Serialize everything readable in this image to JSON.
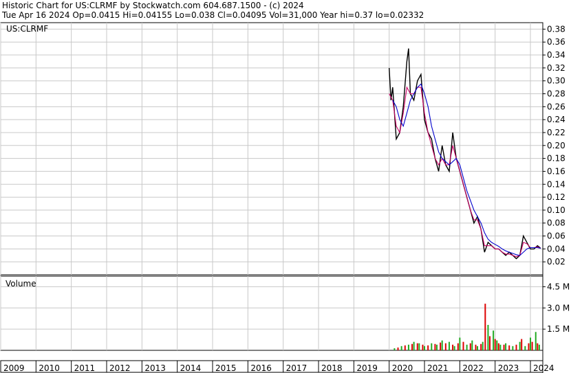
{
  "header": {
    "line1": "Historic Chart for US:CLRMF by Stockwatch.com 604.687.1500 - (c) 2024",
    "line2": "Tue Apr 16 2024   Op=0.0415   Hi=0.04155   Lo=0.038   Cl=0.04095   Vol=31,000   Year hi=0.37   lo=0.02332"
  },
  "chart_data": [
    {
      "type": "line",
      "title": "US:CLRMF",
      "ylim": [
        0.0,
        0.39
      ],
      "yticks": [
        0.02,
        0.04,
        0.06,
        0.08,
        0.1,
        0.12,
        0.14,
        0.16,
        0.18,
        0.2,
        0.22,
        0.24,
        0.26,
        0.28,
        0.3,
        0.32,
        0.34,
        0.36,
        0.38
      ],
      "ytick_labels": [
        "0.02",
        "0.04",
        "0.06",
        "0.08",
        "0.10",
        "0.12",
        "0.14",
        "0.16",
        "0.18",
        "0.20",
        "0.22",
        "0.24",
        "0.26",
        "0.28",
        "0.30",
        "0.32",
        "0.34",
        "0.36",
        "0.38"
      ],
      "xlim": [
        2009.0,
        2024.35
      ],
      "grid": true,
      "series": [
        {
          "color": "#000000",
          "x": [
            2020.0,
            2020.05,
            2020.1,
            2020.15,
            2020.2,
            2020.3,
            2020.4,
            2020.5,
            2020.55,
            2020.6,
            2020.7,
            2020.8,
            2020.9,
            2021.0,
            2021.1,
            2021.2,
            2021.3,
            2021.4,
            2021.5,
            2021.6,
            2021.7,
            2021.8,
            2021.9,
            2022.0,
            2022.1,
            2022.2,
            2022.3,
            2022.4,
            2022.5,
            2022.6,
            2022.7,
            2022.8,
            2022.9,
            2023.0,
            2023.1,
            2023.2,
            2023.3,
            2023.4,
            2023.5,
            2023.6,
            2023.7,
            2023.8,
            2023.9,
            2024.0,
            2024.1,
            2024.2,
            2024.29
          ],
          "y": [
            0.32,
            0.27,
            0.29,
            0.25,
            0.21,
            0.22,
            0.26,
            0.33,
            0.35,
            0.28,
            0.27,
            0.3,
            0.31,
            0.24,
            0.22,
            0.21,
            0.18,
            0.16,
            0.2,
            0.17,
            0.16,
            0.22,
            0.18,
            0.16,
            0.14,
            0.12,
            0.1,
            0.08,
            0.09,
            0.07,
            0.035,
            0.05,
            0.045,
            0.04,
            0.04,
            0.035,
            0.03,
            0.035,
            0.03,
            0.025,
            0.03,
            0.06,
            0.05,
            0.04,
            0.04,
            0.045,
            0.041
          ]
        },
        {
          "color": "#cc0066",
          "x": [
            2020.0,
            2020.1,
            2020.2,
            2020.3,
            2020.4,
            2020.5,
            2020.6,
            2020.7,
            2020.8,
            2020.9,
            2021.0,
            2021.1,
            2021.2,
            2021.3,
            2021.4,
            2021.5,
            2021.6,
            2021.7,
            2021.8,
            2021.9,
            2022.0,
            2022.1,
            2022.2,
            2022.3,
            2022.4,
            2022.5,
            2022.6,
            2022.7,
            2022.8,
            2022.9,
            2023.0,
            2023.1,
            2023.2,
            2023.3,
            2023.4,
            2023.5,
            2023.6,
            2023.7,
            2023.8,
            2023.9,
            2024.0,
            2024.1,
            2024.2,
            2024.29
          ],
          "y": [
            0.28,
            0.27,
            0.23,
            0.22,
            0.25,
            0.29,
            0.28,
            0.28,
            0.29,
            0.29,
            0.25,
            0.22,
            0.2,
            0.18,
            0.17,
            0.18,
            0.17,
            0.17,
            0.2,
            0.18,
            0.16,
            0.14,
            0.12,
            0.1,
            0.085,
            0.085,
            0.07,
            0.045,
            0.045,
            0.045,
            0.04,
            0.04,
            0.035,
            0.032,
            0.032,
            0.03,
            0.028,
            0.03,
            0.05,
            0.048,
            0.042,
            0.042,
            0.043,
            0.041
          ]
        },
        {
          "color": "#0000cc",
          "x": [
            2020.1,
            2020.2,
            2020.3,
            2020.4,
            2020.5,
            2020.6,
            2020.7,
            2020.8,
            2020.9,
            2021.0,
            2021.1,
            2021.2,
            2021.3,
            2021.4,
            2021.5,
            2021.6,
            2021.7,
            2021.8,
            2021.9,
            2022.0,
            2022.1,
            2022.2,
            2022.3,
            2022.4,
            2022.5,
            2022.6,
            2022.7,
            2022.8,
            2022.9,
            2023.0,
            2023.1,
            2023.2,
            2023.3,
            2023.4,
            2023.5,
            2023.6,
            2023.7,
            2023.8,
            2023.9,
            2024.0,
            2024.1,
            2024.2,
            2024.29
          ],
          "y": [
            0.27,
            0.26,
            0.24,
            0.23,
            0.25,
            0.27,
            0.28,
            0.29,
            0.295,
            0.28,
            0.26,
            0.23,
            0.21,
            0.19,
            0.18,
            0.175,
            0.17,
            0.175,
            0.18,
            0.17,
            0.15,
            0.13,
            0.115,
            0.1,
            0.09,
            0.08,
            0.065,
            0.055,
            0.05,
            0.047,
            0.044,
            0.04,
            0.037,
            0.035,
            0.033,
            0.031,
            0.03,
            0.035,
            0.04,
            0.042,
            0.042,
            0.042,
            0.041
          ]
        }
      ]
    },
    {
      "type": "bar",
      "title": "Volume",
      "ylim": [
        0,
        5250000
      ],
      "yticks": [
        1500000,
        3000000,
        4500000
      ],
      "ytick_labels": [
        "1.5 M",
        "3.0 M",
        "4.5 M"
      ],
      "xlim": [
        2009.0,
        2024.35
      ],
      "grid": true,
      "series": [
        {
          "color": "#22aa22",
          "x": [
            2020.15,
            2020.35,
            2020.55,
            2020.7,
            2020.85,
            2021.0,
            2021.2,
            2021.35,
            2021.5,
            2021.7,
            2021.85,
            2022.0,
            2022.2,
            2022.35,
            2022.5,
            2022.65,
            2022.8,
            2022.95,
            2023.05,
            2023.15,
            2023.3,
            2023.5,
            2023.7,
            2023.85,
            2024.0,
            2024.15,
            2024.25
          ],
          "y": [
            150000,
            300000,
            400000,
            600000,
            500000,
            300000,
            500000,
            400000,
            700000,
            600000,
            300000,
            900000,
            400000,
            700000,
            300000,
            600000,
            1800000,
            1400000,
            700000,
            400000,
            500000,
            300000,
            600000,
            300000,
            900000,
            1300000,
            400000
          ]
        },
        {
          "color": "#dd0000",
          "x": [
            2020.25,
            2020.45,
            2020.65,
            2020.8,
            2020.95,
            2021.1,
            2021.3,
            2021.45,
            2021.6,
            2021.8,
            2021.95,
            2022.1,
            2022.3,
            2022.45,
            2022.6,
            2022.72,
            2022.85,
            2023.0,
            2023.1,
            2023.25,
            2023.4,
            2023.6,
            2023.75,
            2023.95,
            2024.05,
            2024.2
          ],
          "y": [
            200000,
            350000,
            450000,
            500000,
            400000,
            350000,
            450000,
            550000,
            500000,
            400000,
            500000,
            600000,
            500000,
            400000,
            450000,
            3300000,
            1000000,
            800000,
            500000,
            400000,
            350000,
            400000,
            800000,
            500000,
            600000,
            500000
          ]
        }
      ]
    },
    {
      "type": "axis",
      "xticks": [
        "2009",
        "2010",
        "2011",
        "2012",
        "2013",
        "2014",
        "2015",
        "2016",
        "2017",
        "2018",
        "2019",
        "2020",
        "2021",
        "2022",
        "2023",
        "2024"
      ]
    }
  ]
}
